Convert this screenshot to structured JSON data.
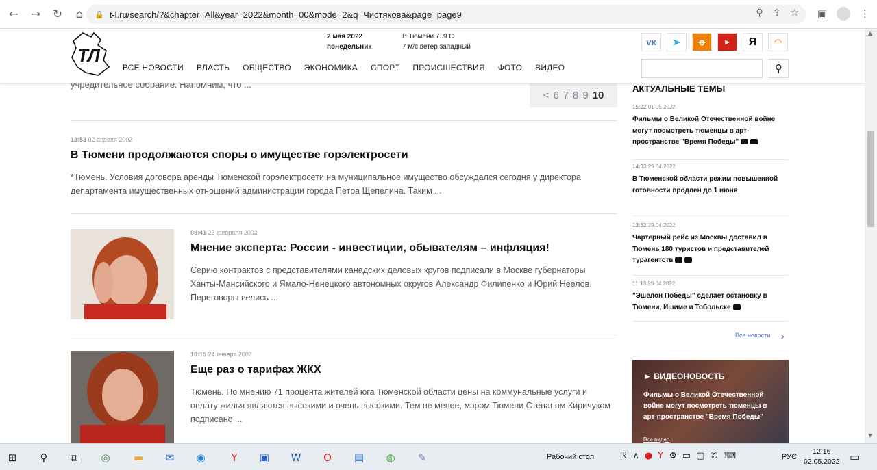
{
  "browser": {
    "url": "t-l.ru/search/?&chapter=All&year=2022&month=00&mode=2&q=Чистякова&page=page9",
    "icons": [
      "back-icon",
      "forward-icon",
      "reload-icon",
      "home-icon",
      "lock-icon",
      "zoom-icon",
      "share-icon",
      "star-icon",
      "extensions-icon",
      "profile-icon",
      "menu-icon"
    ]
  },
  "header": {
    "logo_text": "ТЛ",
    "date": "2 мая 2022",
    "weekday": "понедельник",
    "weather_line1": "В Тюмени 7..9 С",
    "weather_line2": "7 м/с ветер западный",
    "menu": [
      "ВСЕ НОВОСТИ",
      "ВЛАСТЬ",
      "ОБЩЕСТВО",
      "ЭКОНОМИКА",
      "СПОРТ",
      "ПРОИСШЕСТВИЯ",
      "ФОТО",
      "ВИДЕО"
    ],
    "social": [
      {
        "name": "vk",
        "label": "VK",
        "color": "#4a76a8"
      },
      {
        "name": "telegram",
        "label": "➤",
        "color": "#2ca5e0"
      },
      {
        "name": "odnoklassniki",
        "label": "ok",
        "color": "#ee8208"
      },
      {
        "name": "youtube",
        "label": "You",
        "color": "#d22215"
      },
      {
        "name": "yandex",
        "label": "Я",
        "color": "#111111"
      },
      {
        "name": "rss",
        "label": "rss",
        "color": "#f5a623"
      }
    ]
  },
  "top_snippet": "учредительное собрание. Напомним, что ...",
  "pager": {
    "prev": "<",
    "pages": [
      "6",
      "7",
      "8",
      "9"
    ],
    "current": "10"
  },
  "articles": [
    {
      "time": "13:53",
      "date": "02 апреля 2002",
      "title": "В Тюмени продолжаются споры о имуществе горэлектросети",
      "text": "*Тюмень. Условия договора аренды Тюменской горэлектросети на муниципальное имущество обсуждался сегодня у директора департамента имущественных отношений администрации города Петра Щепелина. Таким ..."
    },
    {
      "time": "08:41",
      "date": "26 февраля 2002",
      "title": "Мнение эксперта: России - инвестиции, обывателям – инфляция!",
      "text": "Серию контрактов с представителями канадских деловых кругов подписали в Москве губернаторы Ханты-Мансийского и Ямало-Ненецкого автономных округов Александр Филипенко и Юрий Неелов. Переговоры велись ..."
    },
    {
      "time": "10:15",
      "date": "24 января 2002",
      "title": "Еще раз о тарифах ЖКХ",
      "text": "Тюмень. По мнению 71 процента жителей юга Тюменской области цены на коммунальные услуги и оплату жилья являются высокими и очень высокими. Тем не менее, мэром Тюмени Степаном Киричуком подписано ..."
    }
  ],
  "sidebar": {
    "title": "АКТУАЛЬНЫЕ ТЕМЫ",
    "items": [
      {
        "time": "15:22",
        "date": "01.05.2022",
        "text": "Фильмы о Великой Отечественной войне могут посмотреть тюменцы в арт-пространстве \"Время Победы\"",
        "media": true
      },
      {
        "time": "14:03",
        "date": "29.04.2022",
        "text": "В Тюменской области режим повышенной готовности продлен до 1 июня",
        "media": false
      },
      {
        "time": "13:52",
        "date": "29.04.2022",
        "text": "Чартерный рейс из Москвы доставил в Тюмень 180 туристов и представителей турагентств",
        "media": true
      },
      {
        "time": "11:13",
        "date": "29.04.2022",
        "text": "\"Эшелон Победы\" сделает остановку в Тюмени, Ишиме и Тобольске",
        "media": true
      }
    ],
    "all_news": "Все новости",
    "video": {
      "label": "► ВИДЕОНОВОСТЬ",
      "title": "Фильмы о Великой Отечественной войне могут посмотреть тюменцы в арт-пространстве \"Время Победы\"",
      "all": "Все видео"
    }
  },
  "taskbar": {
    "desktop_label": "Рабочий стол",
    "lang": "РУС",
    "time": "12:16",
    "date": "02.05.2022"
  }
}
